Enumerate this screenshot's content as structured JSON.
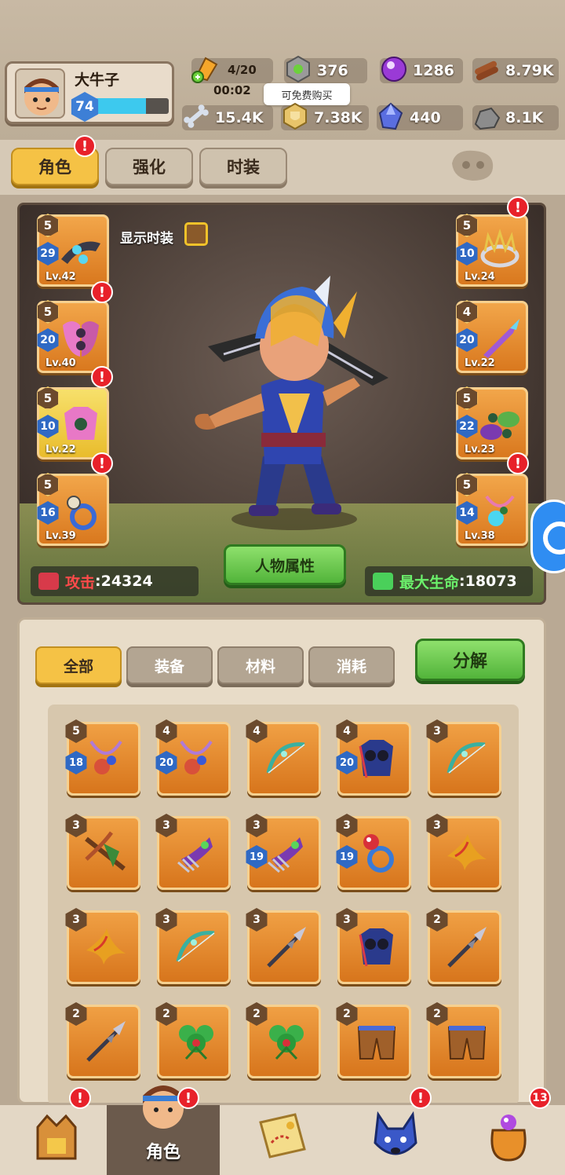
{
  "player": {
    "name": "大牛子",
    "level": "74",
    "xp_fraction": 0.7
  },
  "resources": {
    "stamina_count": "4/20",
    "stamina_timer": "00:02",
    "gear_nut": "376",
    "purple_gem": "1286",
    "wood": "8.79K",
    "bone": "15.4K",
    "shield_coin": "7.38K",
    "crystal": "440",
    "stone": "8.1K"
  },
  "tooltip": "可免费购买",
  "tabs": [
    {
      "label": "角色",
      "active": true
    },
    {
      "label": "强化",
      "active": false
    },
    {
      "label": "时装",
      "active": false
    }
  ],
  "character": {
    "show_skin_label": "显示时装",
    "attr_button": "人物属性",
    "attack_label": "攻击",
    "attack_value": ":24324",
    "hp_label": "最大生命",
    "hp_value": ":18073"
  },
  "equip_left": [
    {
      "stars": "5",
      "level": "29",
      "lv": "Lv.42"
    },
    {
      "stars": "5",
      "level": "20",
      "lv": "Lv.40"
    },
    {
      "stars": "5",
      "level": "10",
      "lv": "Lv.22"
    },
    {
      "stars": "5",
      "level": "16",
      "lv": "Lv.39"
    }
  ],
  "equip_right": [
    {
      "stars": "5",
      "level": "10",
      "lv": "Lv.24"
    },
    {
      "stars": "4",
      "level": "20",
      "lv": "Lv.22"
    },
    {
      "stars": "5",
      "level": "22",
      "lv": "Lv.23"
    },
    {
      "stars": "5",
      "level": "14",
      "lv": "Lv.38"
    }
  ],
  "filters": [
    {
      "label": "全部",
      "active": true
    },
    {
      "label": "装备",
      "active": false
    },
    {
      "label": "材料",
      "active": false
    },
    {
      "label": "消耗",
      "active": false
    }
  ],
  "decompose_label": "分解",
  "inventory": [
    {
      "stars": "5",
      "level": "18",
      "icon": "necklace-icon"
    },
    {
      "stars": "4",
      "level": "20",
      "icon": "necklace-icon"
    },
    {
      "stars": "4",
      "level": "",
      "icon": "bow-icon"
    },
    {
      "stars": "4",
      "level": "20",
      "icon": "armor-icon"
    },
    {
      "stars": "3",
      "level": "",
      "icon": "bow-icon"
    },
    {
      "stars": "3",
      "level": "",
      "icon": "crossbow-icon"
    },
    {
      "stars": "3",
      "level": "",
      "icon": "claw-icon"
    },
    {
      "stars": "3",
      "level": "19",
      "icon": "claw-icon"
    },
    {
      "stars": "3",
      "level": "19",
      "icon": "ring-icon"
    },
    {
      "stars": "3",
      "level": "",
      "icon": "boomerang-icon"
    },
    {
      "stars": "3",
      "level": "",
      "icon": "boomerang-icon"
    },
    {
      "stars": "3",
      "level": "",
      "icon": "bow-icon"
    },
    {
      "stars": "3",
      "level": "",
      "icon": "spear-icon"
    },
    {
      "stars": "3",
      "level": "",
      "icon": "armor-icon"
    },
    {
      "stars": "2",
      "level": "",
      "icon": "spear-icon"
    },
    {
      "stars": "2",
      "level": "",
      "icon": "spear-icon"
    },
    {
      "stars": "2",
      "level": "",
      "icon": "clover-icon"
    },
    {
      "stars": "2",
      "level": "",
      "icon": "clover-icon"
    },
    {
      "stars": "2",
      "level": "",
      "icon": "pants-icon"
    },
    {
      "stars": "2",
      "level": "",
      "icon": "pants-icon"
    }
  ],
  "nav": [
    {
      "label": "",
      "icon": "throne-icon"
    },
    {
      "label": "角色",
      "icon": "hero-icon"
    },
    {
      "label": "",
      "icon": "map-icon"
    },
    {
      "label": "",
      "icon": "wolf-icon"
    },
    {
      "label": "",
      "icon": "bag-icon",
      "badge": "13"
    }
  ]
}
